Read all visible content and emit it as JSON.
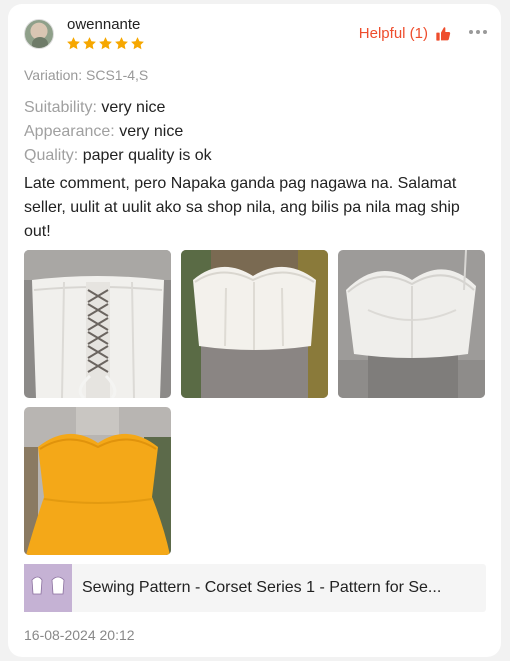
{
  "review": {
    "username": "owennante",
    "rating": 5,
    "helpful_label": "Helpful (1)",
    "variation": "Variation: SCS1-4,S",
    "attributes": [
      {
        "label": "Suitability:",
        "value": "very nice"
      },
      {
        "label": "Appearance:",
        "value": "very nice"
      },
      {
        "label": "Quality:",
        "value": "paper quality is ok"
      }
    ],
    "comment": "Late comment, pero Napaka ganda pag nagawa na. Salamat seller, uulit at uulit ako sa shop nila, ang bilis pa nila mag ship out!",
    "photo_count": 4,
    "product_name": "Sewing Pattern - Corset Series 1 - Pattern for Se...",
    "date": "16-08-2024 20:12"
  },
  "colors": {
    "accent": "#ee4d2d",
    "star": "#f6a700",
    "muted_text": "#999999"
  },
  "icons": {
    "rating": "star-icon",
    "helpful": "thumbs-up-icon",
    "menu": "more-options-icon"
  }
}
